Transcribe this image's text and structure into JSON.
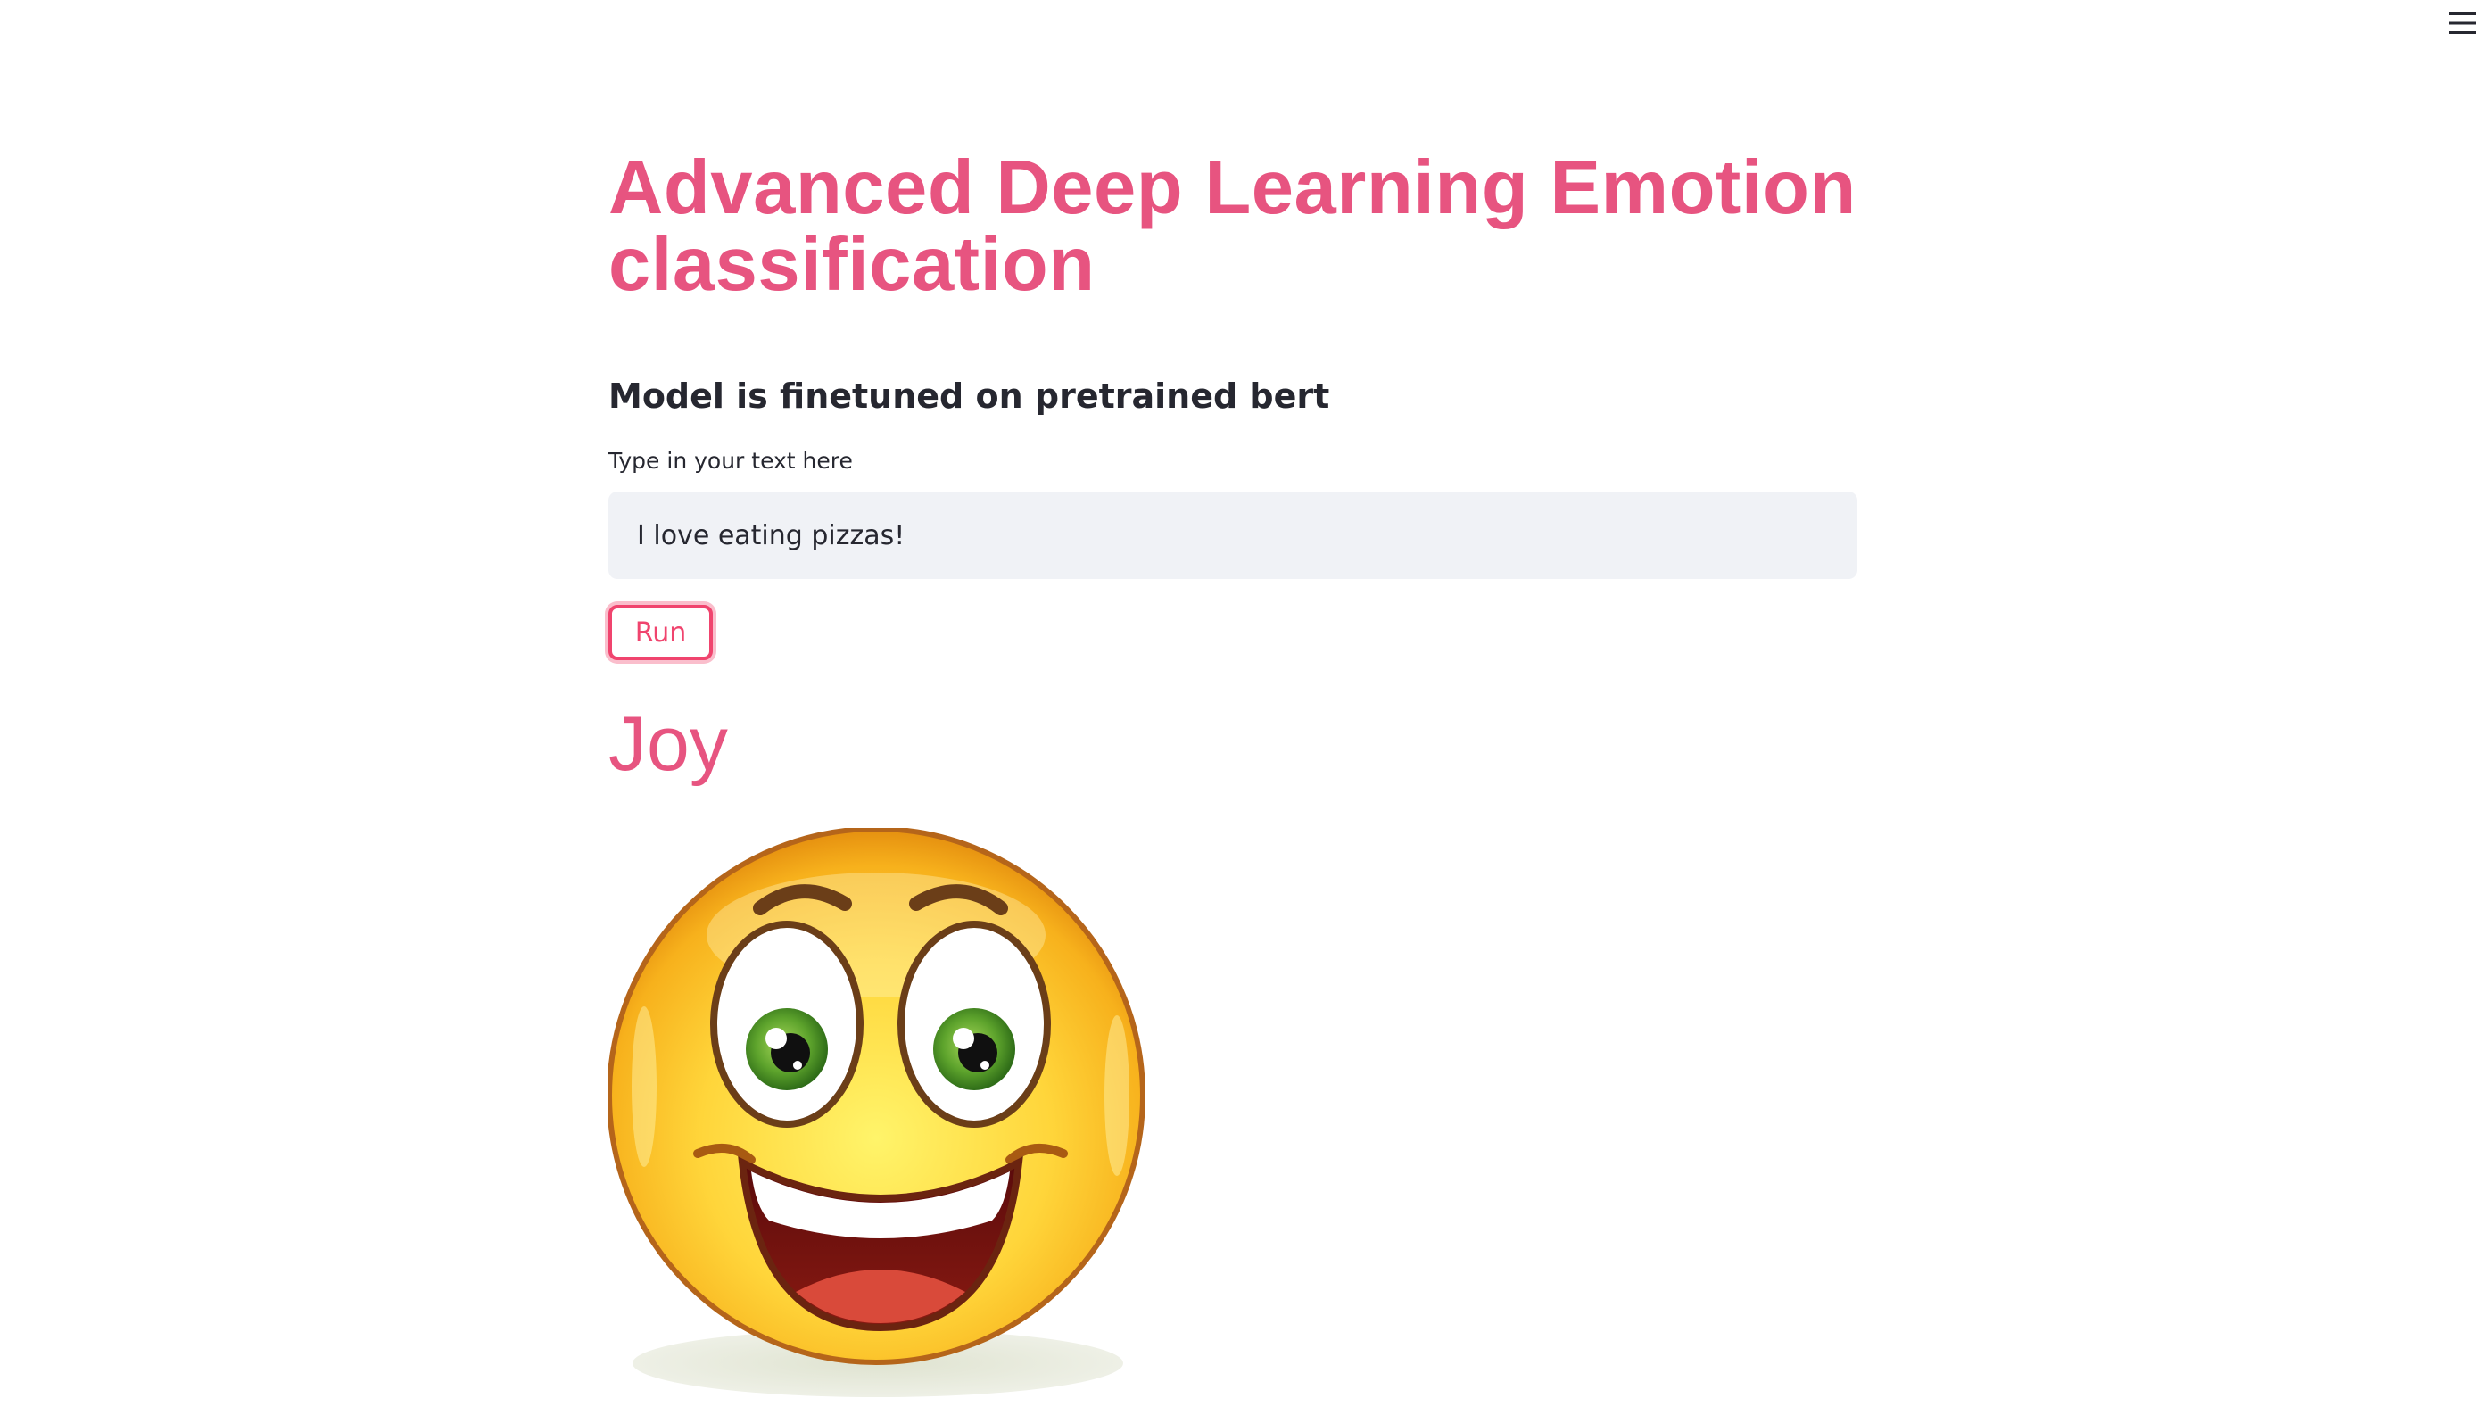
{
  "header": {
    "menu_icon": "hamburger-menu-icon"
  },
  "main": {
    "title": "Advanced Deep Learning Emotion classification",
    "subtitle": "Model is finetuned on pretrained bert",
    "input_label": "Type in your text here",
    "input_value": "I love eating pizzas!",
    "run_button_label": "Run",
    "result_label": "Joy",
    "result_image_icon": "smiling-face-emoji-icon"
  },
  "colors": {
    "accent": "#e75480",
    "button_accent": "#f0446e",
    "input_background": "#f0f2f6",
    "text": "#262730"
  }
}
